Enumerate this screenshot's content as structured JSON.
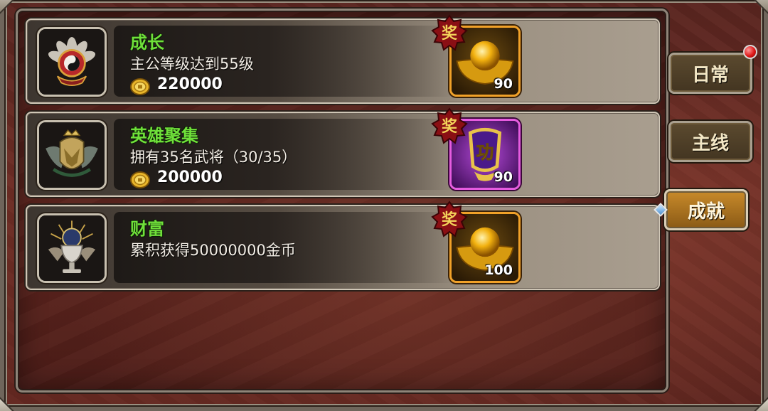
{
  "achievements": [
    {
      "title": "成长",
      "description": "主公等级达到55级",
      "coin_value": "220000",
      "icon": "taiji-lotus-emblem-icon",
      "reward": {
        "icon": "gold-ingot-icon",
        "count": "90",
        "frame_color": "#f1a128"
      },
      "badge": "奖"
    },
    {
      "title": "英雄聚集",
      "description": "拥有35名武将（30/35）",
      "coin_value": "200000",
      "icon": "winged-helmet-emblem-icon",
      "reward": {
        "icon": "merit-token-icon",
        "token_char": "功",
        "count": "90",
        "frame_color": "#e65ce0"
      },
      "badge": "奖"
    },
    {
      "title": "财富",
      "description": "累积获得50000000金币",
      "coin_value": "",
      "icon": "chalice-trophy-emblem-icon",
      "reward": {
        "icon": "gold-ingot-icon",
        "count": "100",
        "frame_color": "#f1a128"
      },
      "badge": "奖"
    }
  ],
  "tabs": [
    {
      "label": "日常",
      "active": false,
      "has_notification": true
    },
    {
      "label": "主线",
      "active": false,
      "has_notification": false
    },
    {
      "label": "成就",
      "active": true,
      "has_notification": false
    }
  ],
  "colors": {
    "title_green": "#6fe03a",
    "active_tab": "#c88a2a",
    "gold_frame": "#f1a128",
    "purple_frame": "#e65ce0"
  }
}
